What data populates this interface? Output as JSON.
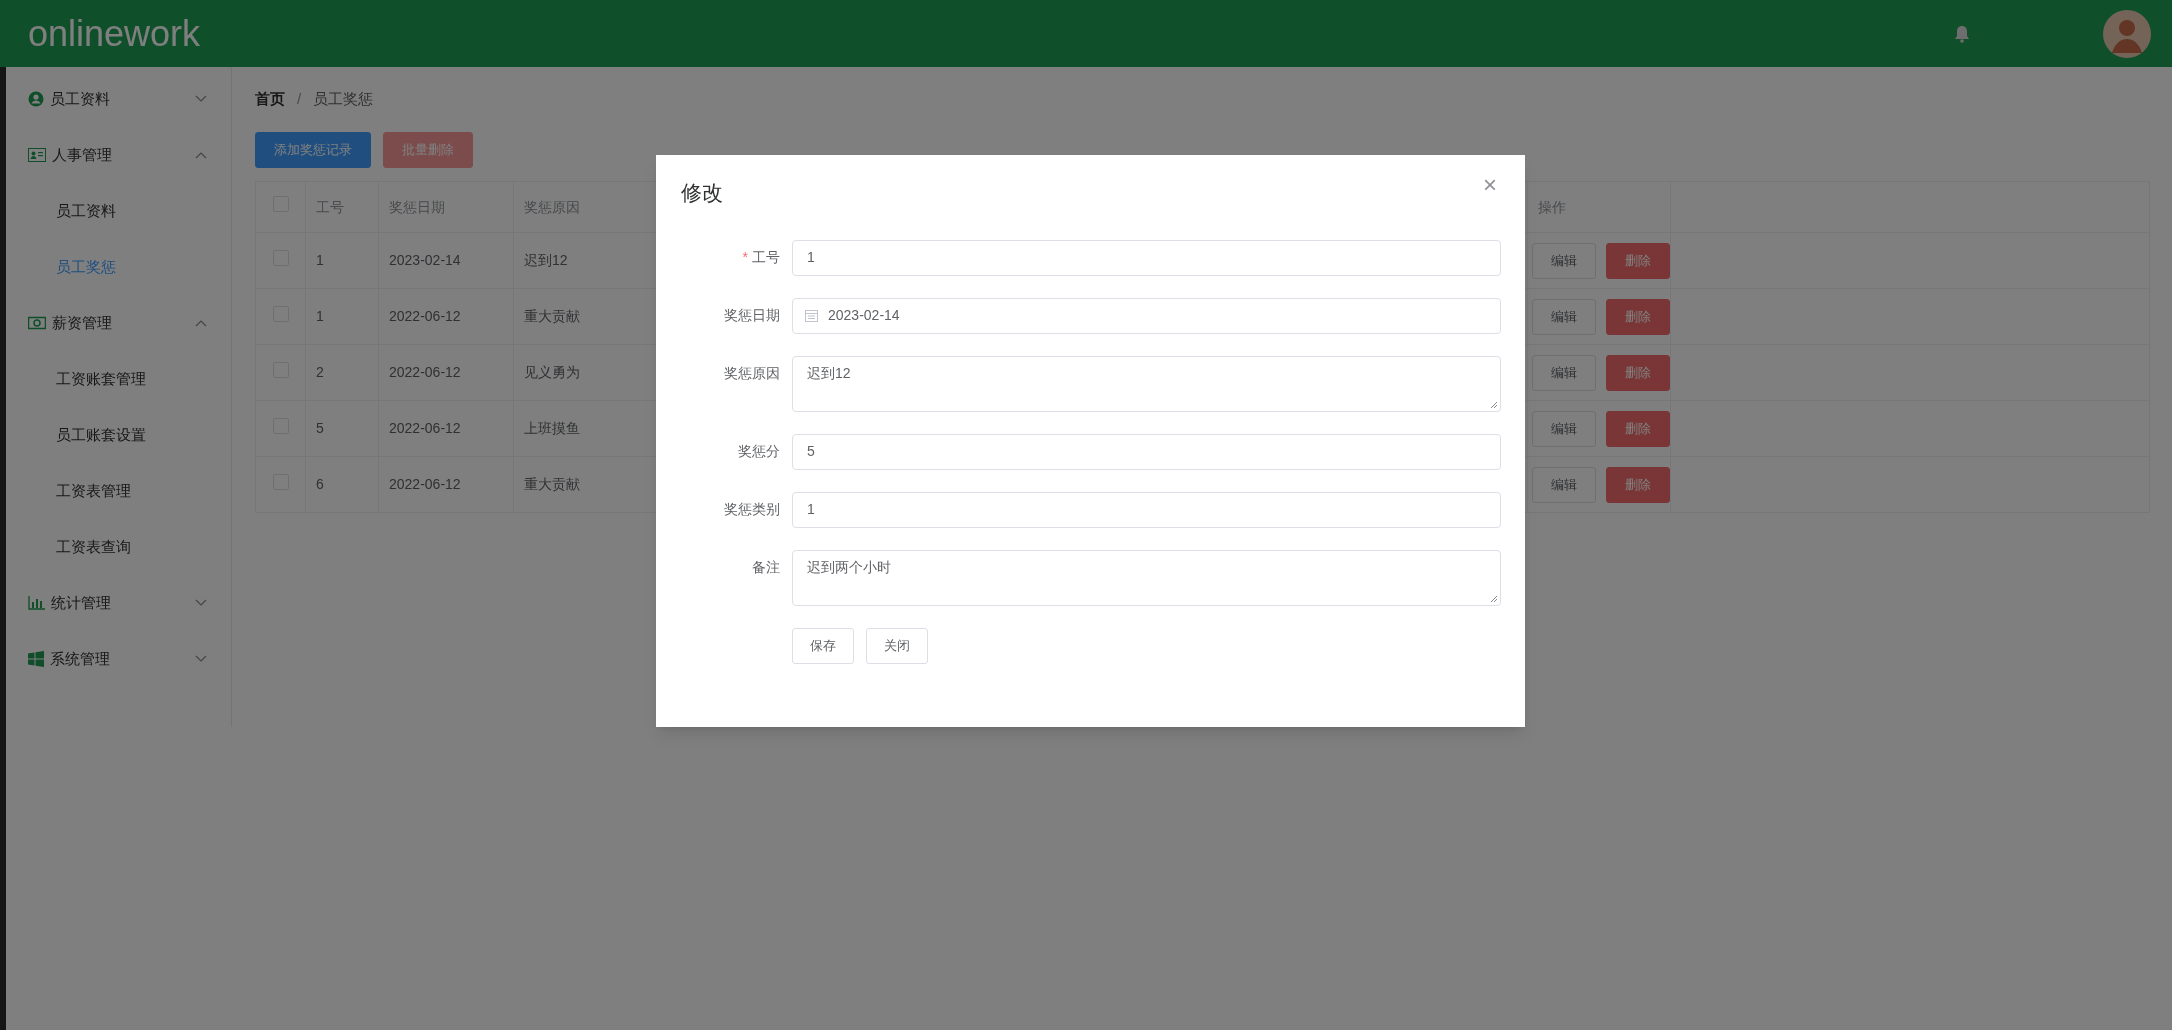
{
  "header": {
    "logo": "onlinework"
  },
  "sidebar": {
    "items": [
      {
        "label": "员工资料",
        "kind": "user",
        "expanded": false
      },
      {
        "label": "人事管理",
        "kind": "card",
        "expanded": true,
        "children": [
          {
            "label": "员工资料",
            "selected": false
          },
          {
            "label": "员工奖惩",
            "selected": true
          }
        ]
      },
      {
        "label": "薪资管理",
        "kind": "money",
        "expanded": true,
        "children": [
          {
            "label": "工资账套管理",
            "selected": false
          },
          {
            "label": "员工账套设置",
            "selected": false
          },
          {
            "label": "工资表管理",
            "selected": false
          },
          {
            "label": "工资表查询",
            "selected": false
          }
        ]
      },
      {
        "label": "统计管理",
        "kind": "chart",
        "expanded": false
      },
      {
        "label": "系统管理",
        "kind": "windows",
        "expanded": false
      }
    ]
  },
  "breadcrumb": {
    "items": [
      "首页",
      "员工奖惩"
    ],
    "separator": "/"
  },
  "toolbar": [
    {
      "label": "添加奖惩记录",
      "kind": "primary"
    },
    {
      "label": "批量删除",
      "kind": "danger"
    }
  ],
  "table": {
    "all_checked": false,
    "columns": [
      "工号",
      "奖惩日期",
      "奖惩原因",
      "操作"
    ],
    "rows": [
      {
        "checked": false,
        "cells": [
          "1",
          "2023-02-14",
          "迟到12"
        ],
        "actions": [
          "编辑",
          "删除"
        ]
      },
      {
        "checked": false,
        "cells": [
          "1",
          "2022-06-12",
          "重大贡献"
        ],
        "actions": [
          "编辑",
          "删除"
        ]
      },
      {
        "checked": false,
        "cells": [
          "2",
          "2022-06-12",
          "见义勇为"
        ],
        "actions": [
          "编辑",
          "删除"
        ]
      },
      {
        "checked": false,
        "cells": [
          "5",
          "2022-06-12",
          "上班摸鱼"
        ],
        "actions": [
          "编辑",
          "删除"
        ]
      },
      {
        "checked": false,
        "cells": [
          "6",
          "2022-06-12",
          "重大贡献"
        ],
        "actions": [
          "编辑",
          "删除"
        ]
      }
    ]
  },
  "dialog": {
    "title": "修改",
    "close": "×",
    "required_mark": "*",
    "fields": [
      {
        "label": "工号",
        "required": true,
        "kind": "input",
        "value": "1"
      },
      {
        "label": "奖惩日期",
        "required": false,
        "kind": "date",
        "value": "2023-02-14"
      },
      {
        "label": "奖惩原因",
        "required": false,
        "kind": "textarea",
        "value": "迟到12"
      },
      {
        "label": "奖惩分",
        "required": false,
        "kind": "input",
        "value": "5"
      },
      {
        "label": "奖惩类别",
        "required": false,
        "kind": "input",
        "value": "1"
      },
      {
        "label": "备注",
        "required": false,
        "kind": "textarea",
        "value": "迟到两个小时"
      }
    ],
    "buttons": [
      "保存",
      "关闭"
    ]
  }
}
